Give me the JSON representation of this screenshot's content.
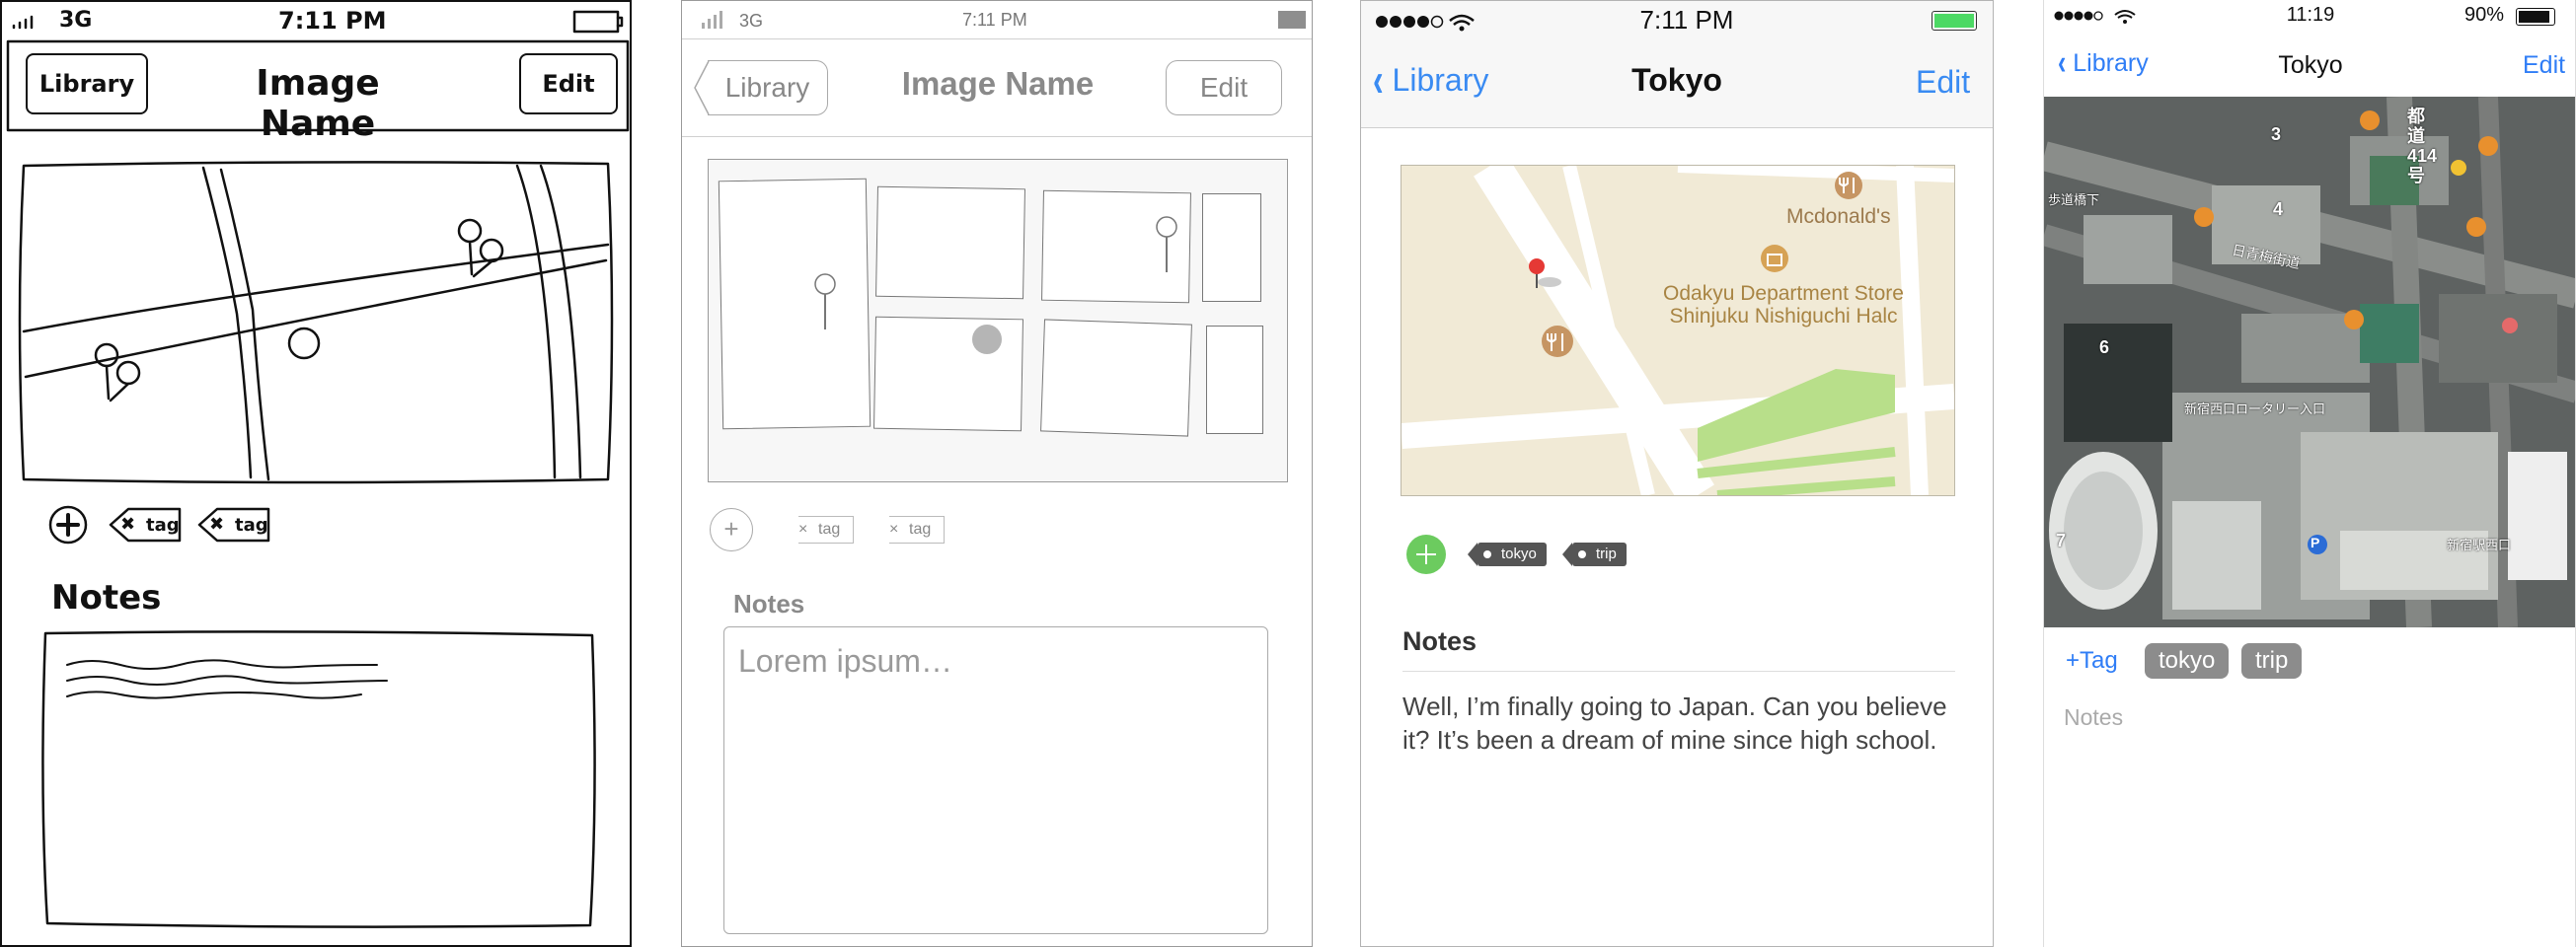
{
  "frame1": {
    "carrier": "3G",
    "time": "7:11 PM",
    "back_label": "Library",
    "title": "Image Name",
    "edit_label": "Edit",
    "tags": [
      "tag",
      "tag"
    ],
    "notes_label": "Notes"
  },
  "frame2": {
    "carrier": "3G",
    "time": "7:11 PM",
    "back_label": "Library",
    "title": "Image Name",
    "edit_label": "Edit",
    "tags": [
      "tag",
      "tag"
    ],
    "notes_label": "Notes",
    "notes_placeholder": "Lorem ipsum…"
  },
  "frame3": {
    "time": "7:11 PM",
    "back_label": "Library",
    "title": "Tokyo",
    "edit_label": "Edit",
    "map": {
      "poi_1": "Mcdonald's",
      "poi_2": "Odakyu Department Store Shinjuku Nishiguchi Halc"
    },
    "tags": [
      "tokyo",
      "trip"
    ],
    "notes_label": "Notes",
    "notes_text": "Well, I’m finally going to Japan. Can you believe it? It’s been a dream of mine since high school.",
    "colors": {
      "accent": "#3a8bf2",
      "add_button": "#6ccb5f",
      "tag": "#555555",
      "battery": "#4cd964"
    }
  },
  "frame4": {
    "time": "11:19",
    "battery": "90%",
    "back_label": "Library",
    "title": "Tokyo",
    "edit_label": "Edit",
    "map": {
      "label_1": "都道414号",
      "label_2": "日青梅街道",
      "label_3": "新宿西口ロータリー入口",
      "label_4": "新宿駅西口",
      "label_5": "3",
      "label_6": "4",
      "label_7": "6",
      "label_8": "7",
      "label_9": "P",
      "label_10": "歩道橋下"
    },
    "add_tag_label": "+Tag",
    "tags": [
      "tokyo",
      "trip"
    ],
    "notes_placeholder": "Notes",
    "colors": {
      "accent": "#2f7df6",
      "pill": "#8c8c8c"
    }
  }
}
